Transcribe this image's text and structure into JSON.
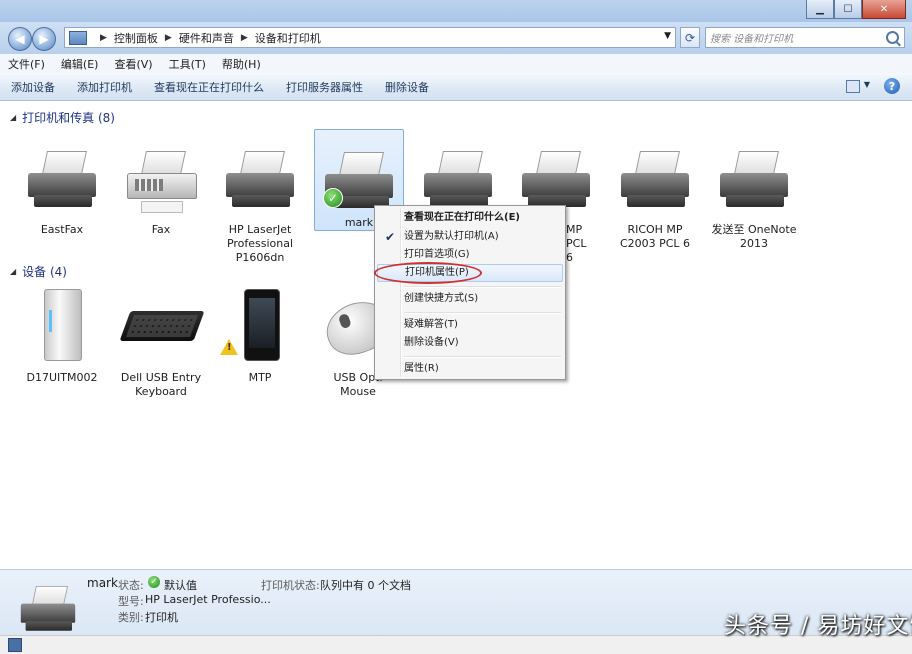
{
  "window": {
    "min": "▁",
    "max": "☐",
    "close": "✕"
  },
  "address": {
    "crumbs": [
      "控制面板",
      "硬件和声音",
      "设备和打印机"
    ],
    "search_placeholder": "搜索 设备和打印机"
  },
  "menubar": [
    "文件(F)",
    "编辑(E)",
    "查看(V)",
    "工具(T)",
    "帮助(H)"
  ],
  "commands": [
    "添加设备",
    "添加打印机",
    "查看现在正在打印什么",
    "打印服务器属性",
    "删除设备"
  ],
  "groups": {
    "printers": "打印机和传真 (8)",
    "devices": "设备 (4)"
  },
  "printers": [
    {
      "name": "EastFax"
    },
    {
      "name": "Fax"
    },
    {
      "name": "HP LaserJet Professional P1606dn"
    },
    {
      "name": "mark"
    },
    {
      "name": ""
    },
    {
      "name": "MP PCL 6"
    },
    {
      "name": "RICOH MP C2003 PCL 6"
    },
    {
      "name": "发送至 OneNote 2013"
    }
  ],
  "devices": [
    {
      "name": "D17UITM002"
    },
    {
      "name": "Dell USB Entry Keyboard"
    },
    {
      "name": "MTP"
    },
    {
      "name": "USB Opti Mouse"
    }
  ],
  "context_menu": [
    {
      "label": "查看现在正在打印什么(E)",
      "bold": true
    },
    {
      "label": "设置为默认打印机(A)",
      "checked": true
    },
    {
      "label": "打印首选项(G)"
    },
    {
      "label": "打印机属性(P)",
      "highlighted": true
    },
    {
      "label": "创建快捷方式(S)"
    },
    {
      "label": "疑难解答(T)"
    },
    {
      "label": "删除设备(V)"
    },
    {
      "label": "属性(R)"
    }
  ],
  "details": {
    "name": "mark",
    "status_key": "状态:",
    "status_val": "默认值",
    "printer_status_key": "打印机状态:",
    "printer_status_val": "队列中有 0 个文档",
    "model_key": "型号:",
    "model_val": "HP LaserJet Professio...",
    "category_key": "类别:",
    "category_val": "打印机"
  },
  "watermark": "头条号 / 易坊好文馆"
}
